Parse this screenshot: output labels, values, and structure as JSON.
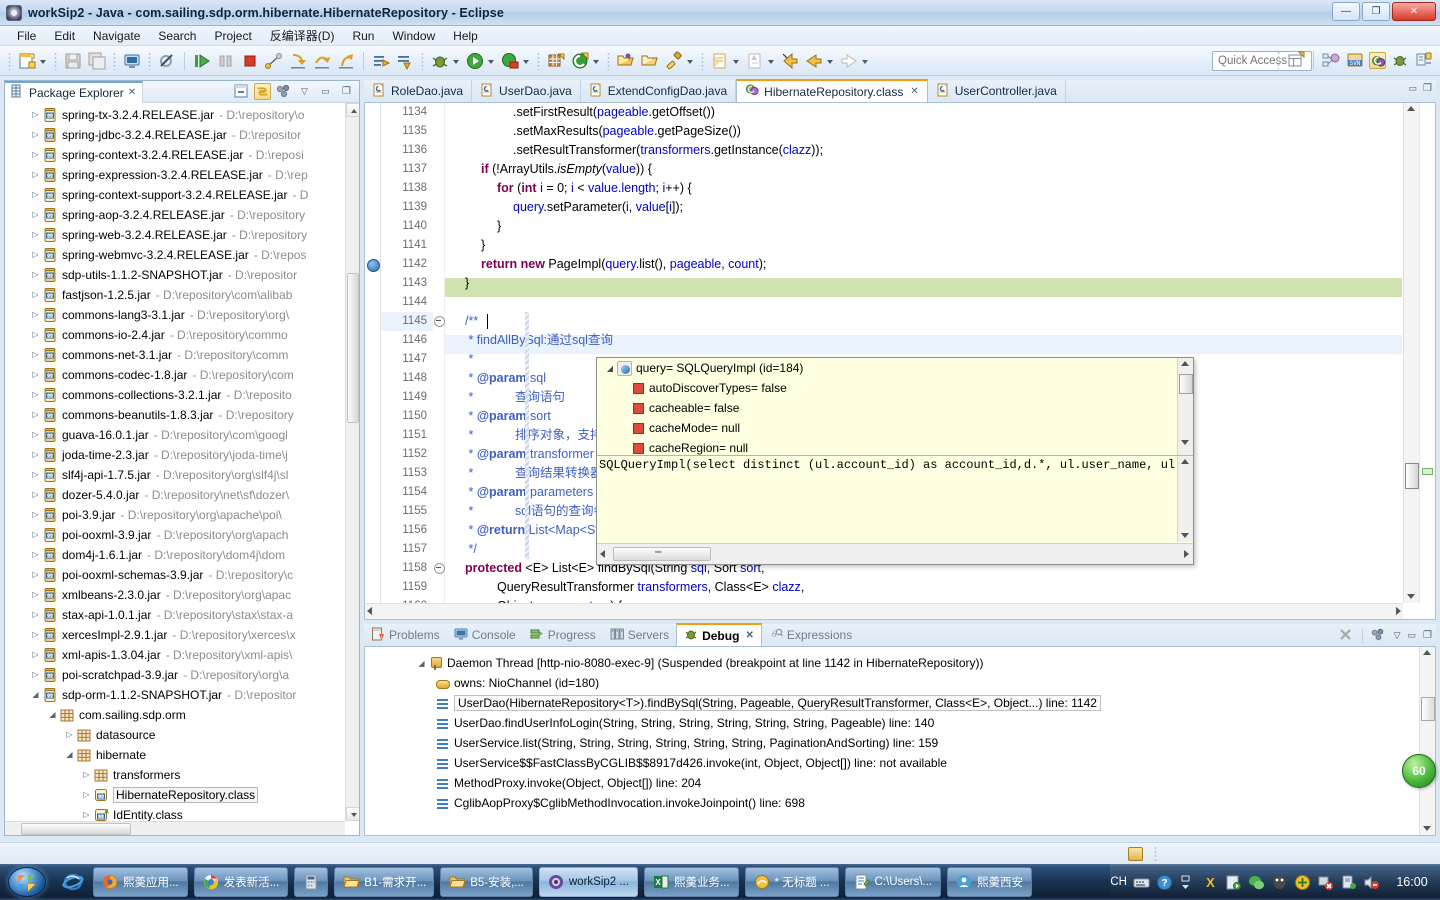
{
  "window": {
    "title": "workSip2 - Java - com.sailing.sdp.orm.hibernate.HibernateRepository - Eclipse",
    "minimize_label": "—",
    "maximize_label": "❐",
    "close_label": "✕"
  },
  "menubar": {
    "items": [
      "File",
      "Edit",
      "Navigate",
      "Search",
      "Project",
      "反编译器(D)",
      "Run",
      "Window",
      "Help"
    ]
  },
  "toolbar": {
    "quick_access_placeholder": "Quick Access",
    "left_icons": [
      "new-wizard-icon",
      "new-dropdown-arrow",
      "save-icon",
      "save-all-icon",
      "print-icon",
      "toggle-breakpoint-icon",
      "resume-icon",
      "suspend-icon",
      "terminate-icon",
      "disconnect-icon",
      "step-into-icon",
      "step-over-icon",
      "step-return-icon",
      "run-to-line-icon",
      "use-step-filters-icon",
      "debug-icon",
      "debug-dropdown-arrow",
      "run-icon",
      "run-dropdown-arrow",
      "coverage-icon",
      "coverage-dropdown-arrow",
      "new-java-package-icon",
      "new-java-class-icon",
      "new-class-dropdown-arrow",
      "open-type-icon",
      "open-task-icon",
      "search-icon",
      "search-dropdown-arrow",
      "next-annotation-icon",
      "next-annotation-dropdown-arrow",
      "previous-annotation-icon",
      "previous-annotation-dropdown-arrow",
      "back-icon",
      "forward-icon",
      "forward-dropdown-arrow",
      "next-edit-icon",
      "next-edit-dropdown-arrow"
    ],
    "right_icons": [
      "open-perspective-icon",
      "java-perspective-icon",
      "svn-perspective-icon",
      "java-ee-perspective-icon",
      "debug-perspective-icon",
      "team-sync-perspective-icon"
    ]
  },
  "package_explorer": {
    "title": "Package Explorer",
    "close_label": "✕",
    "toolbar_icons": [
      "collapse-all-icon",
      "link-with-editor-icon",
      "view-menu-icon",
      "minimize-icon",
      "maximize-icon"
    ],
    "view_menu_label": "▽",
    "minimize_label": "▭",
    "maximize_label": "❐",
    "items": [
      {
        "name": "spring-tx-3.2.4.RELEASE.jar",
        "path": "- D:\\repository\\o",
        "icon": "jar-src-icon",
        "indent": 2,
        "twisty": "▷"
      },
      {
        "name": "spring-jdbc-3.2.4.RELEASE.jar",
        "path": "- D:\\repositor",
        "icon": "jar-icon",
        "indent": 2,
        "twisty": "▷"
      },
      {
        "name": "spring-context-3.2.4.RELEASE.jar",
        "path": "- D:\\reposi",
        "icon": "jar-src-icon",
        "indent": 2,
        "twisty": "▷"
      },
      {
        "name": "spring-expression-3.2.4.RELEASE.jar",
        "path": "- D:\\rep",
        "icon": "jar-icon",
        "indent": 2,
        "twisty": "▷"
      },
      {
        "name": "spring-context-support-3.2.4.RELEASE.jar",
        "path": "- D",
        "icon": "jar-src-icon",
        "indent": 2,
        "twisty": "▷"
      },
      {
        "name": "spring-aop-3.2.4.RELEASE.jar",
        "path": "- D:\\repository",
        "icon": "jar-src-icon",
        "indent": 2,
        "twisty": "▷"
      },
      {
        "name": "spring-web-3.2.4.RELEASE.jar",
        "path": "- D:\\repository",
        "icon": "jar-src-icon",
        "indent": 2,
        "twisty": "▷"
      },
      {
        "name": "spring-webmvc-3.2.4.RELEASE.jar",
        "path": "- D:\\repos",
        "icon": "jar-src-icon",
        "indent": 2,
        "twisty": "▷"
      },
      {
        "name": "sdp-utils-1.1.2-SNAPSHOT.jar",
        "path": "- D:\\repositor",
        "icon": "jar-icon",
        "indent": 2,
        "twisty": "▷"
      },
      {
        "name": "fastjson-1.2.5.jar",
        "path": "- D:\\repository\\com\\alibab",
        "icon": "jar-src-icon",
        "indent": 2,
        "twisty": "▷"
      },
      {
        "name": "commons-lang3-3.1.jar",
        "path": "- D:\\repository\\org\\",
        "icon": "jar-src-icon",
        "indent": 2,
        "twisty": "▷"
      },
      {
        "name": "commons-io-2.4.jar",
        "path": "- D:\\repository\\commo",
        "icon": "jar-src-icon",
        "indent": 2,
        "twisty": "▷"
      },
      {
        "name": "commons-net-3.1.jar",
        "path": "- D:\\repository\\comm",
        "icon": "jar-icon",
        "indent": 2,
        "twisty": "▷"
      },
      {
        "name": "commons-codec-1.8.jar",
        "path": "- D:\\repository\\com",
        "icon": "jar-icon",
        "indent": 2,
        "twisty": "▷"
      },
      {
        "name": "commons-collections-3.2.1.jar",
        "path": "- D:\\reposito",
        "icon": "jar-src-icon",
        "indent": 2,
        "twisty": "▷"
      },
      {
        "name": "commons-beanutils-1.8.3.jar",
        "path": "- D:\\repository",
        "icon": "jar-icon",
        "indent": 2,
        "twisty": "▷"
      },
      {
        "name": "guava-16.0.1.jar",
        "path": "- D:\\repository\\com\\googl",
        "icon": "jar-icon",
        "indent": 2,
        "twisty": "▷"
      },
      {
        "name": "joda-time-2.3.jar",
        "path": "- D:\\repository\\joda-time\\j",
        "icon": "jar-icon",
        "indent": 2,
        "twisty": "▷"
      },
      {
        "name": "slf4j-api-1.7.5.jar",
        "path": "- D:\\repository\\org\\slf4j\\sl",
        "icon": "jar-src-icon",
        "indent": 2,
        "twisty": "▷"
      },
      {
        "name": "dozer-5.4.0.jar",
        "path": "- D:\\repository\\net\\sf\\dozer\\",
        "icon": "jar-icon",
        "indent": 2,
        "twisty": "▷"
      },
      {
        "name": "poi-3.9.jar",
        "path": "- D:\\repository\\org\\apache\\poi\\",
        "icon": "jar-icon",
        "indent": 2,
        "twisty": "▷"
      },
      {
        "name": "poi-ooxml-3.9.jar",
        "path": "- D:\\repository\\org\\apach",
        "icon": "jar-src-icon",
        "indent": 2,
        "twisty": "▷"
      },
      {
        "name": "dom4j-1.6.1.jar",
        "path": "- D:\\repository\\dom4j\\dom",
        "icon": "jar-icon",
        "indent": 2,
        "twisty": "▷"
      },
      {
        "name": "poi-ooxml-schemas-3.9.jar",
        "path": "- D:\\repository\\c",
        "icon": "jar-icon",
        "indent": 2,
        "twisty": "▷"
      },
      {
        "name": "xmlbeans-2.3.0.jar",
        "path": "- D:\\repository\\org\\apac",
        "icon": "jar-icon",
        "indent": 2,
        "twisty": "▷"
      },
      {
        "name": "stax-api-1.0.1.jar",
        "path": "- D:\\repository\\stax\\stax-a",
        "icon": "jar-icon",
        "indent": 2,
        "twisty": "▷"
      },
      {
        "name": "xercesImpl-2.9.1.jar",
        "path": "- D:\\repository\\xerces\\x",
        "icon": "jar-icon",
        "indent": 2,
        "twisty": "▷"
      },
      {
        "name": "xml-apis-1.3.04.jar",
        "path": "- D:\\repository\\xml-apis\\",
        "icon": "jar-icon",
        "indent": 2,
        "twisty": "▷"
      },
      {
        "name": "poi-scratchpad-3.9.jar",
        "path": "- D:\\repository\\org\\a",
        "icon": "jar-icon",
        "indent": 2,
        "twisty": "▷"
      },
      {
        "name": "sdp-orm-1.1.2-SNAPSHOT.jar",
        "path": "- D:\\repositor",
        "icon": "jar-src-icon",
        "indent": 2,
        "twisty": "◢"
      },
      {
        "name": "com.sailing.sdp.orm",
        "path": "",
        "icon": "package-icon",
        "indent": 3,
        "twisty": "◢"
      },
      {
        "name": "datasource",
        "path": "",
        "icon": "package-icon",
        "indent": 4,
        "twisty": "▷"
      },
      {
        "name": "hibernate",
        "path": "",
        "icon": "package-icon",
        "indent": 4,
        "twisty": "◢"
      },
      {
        "name": "transformers",
        "path": "",
        "icon": "package-icon",
        "indent": 5,
        "twisty": "▷"
      },
      {
        "name": "HibernateRepository.class",
        "path": "",
        "icon": "class-icon",
        "indent": 5,
        "twisty": "▷",
        "selected": true
      },
      {
        "name": "IdEntity.class",
        "path": "",
        "icon": "class-abstract-icon",
        "indent": 5,
        "twisty": "▷"
      }
    ]
  },
  "editor": {
    "tabs": [
      {
        "label": "RoleDao.java",
        "icon": "java-file-icon",
        "active": false
      },
      {
        "label": "UserDao.java",
        "icon": "java-file-icon",
        "active": false
      },
      {
        "label": "ExtendConfigDao.java",
        "icon": "java-file-icon",
        "active": false
      },
      {
        "label": "HibernateRepository.class",
        "icon": "class-file-icon",
        "active": true,
        "close_label": "✕"
      },
      {
        "label": "UserController.java",
        "icon": "java-file-icon",
        "active": false
      }
    ],
    "minimize_label": "▭",
    "maximize_label": "❐",
    "first_line_number": 1134,
    "current_line": 1145,
    "breakpoint_line": 1142,
    "highlighted_line": 1142,
    "lines": [
      {
        "n": 1134,
        "indent": "\t\t\t\t",
        "text": ".setFirstResult(pageable.getOffset())"
      },
      {
        "n": 1135,
        "indent": "\t\t\t\t",
        "text": ".setMaxResults(pageable.getPageSize())"
      },
      {
        "n": 1136,
        "indent": "\t\t\t\t",
        "text": ".setResultTransformer(transformers.getInstance(clazz));"
      },
      {
        "n": 1137,
        "indent": "\t\t",
        "text": "if (!ArrayUtils.isEmpty(value)) {"
      },
      {
        "n": 1138,
        "indent": "\t\t\t",
        "text": "for (int i = 0; i < value.length; i++) {"
      },
      {
        "n": 1139,
        "indent": "\t\t\t\t",
        "text": "query.setParameter(i, value[i]);"
      },
      {
        "n": 1140,
        "indent": "\t\t\t",
        "text": "}"
      },
      {
        "n": 1141,
        "indent": "\t\t",
        "text": "}"
      },
      {
        "n": 1142,
        "indent": "\t\t",
        "text": "return new PageImpl(query.list(), pageable, count);"
      },
      {
        "n": 1143,
        "indent": "\t",
        "text": "}"
      },
      {
        "n": 1144,
        "indent": "",
        "text": ""
      },
      {
        "n": 1145,
        "indent": "\t",
        "text": "/**"
      },
      {
        "n": 1146,
        "indent": "\t",
        "text": " * findAllBySql:通过sql查询"
      },
      {
        "n": 1147,
        "indent": "\t",
        "text": " * "
      },
      {
        "n": 1148,
        "indent": "\t",
        "text": " * @param sql"
      },
      {
        "n": 1149,
        "indent": "\t",
        "text": " *            查询语句"
      },
      {
        "n": 1150,
        "indent": "\t",
        "text": " * @param sort"
      },
      {
        "n": 1151,
        "indent": "\t",
        "text": " *            排序对象，支持多"
      },
      {
        "n": 1152,
        "indent": "\t",
        "text": " * @param transformer"
      },
      {
        "n": 1153,
        "indent": "\t",
        "text": " *            查询结果转换器"
      },
      {
        "n": 1154,
        "indent": "\t",
        "text": " * @param parameters"
      },
      {
        "n": 1155,
        "indent": "\t",
        "text": " *            sql语句的查询参数"
      },
      {
        "n": 1156,
        "indent": "\t",
        "text": " * @return List<Map<String,Object>>"
      },
      {
        "n": 1157,
        "indent": "\t",
        "text": " */"
      },
      {
        "n": 1158,
        "indent": "\t",
        "text": "protected <E> List<E> findBySql(String sql, Sort sort,"
      },
      {
        "n": 1159,
        "indent": "\t\t\t",
        "text": "QueryResultTransformer transformers, Class<E> clazz,"
      },
      {
        "n": 1160,
        "indent": "\t\t\t",
        "text": "Object... parameters) {"
      }
    ]
  },
  "hover_popup": {
    "variables": [
      {
        "label": "query= SQLQueryImpl  (id=184)",
        "icon": "object-icon",
        "twisty": "◢",
        "depth": 0
      },
      {
        "label": "autoDiscoverTypes= false",
        "icon": "field-private-icon",
        "depth": 1
      },
      {
        "label": "cacheable= false",
        "icon": "field-private-icon",
        "depth": 1
      },
      {
        "label": "cacheMode= null",
        "icon": "field-private-icon",
        "depth": 1
      },
      {
        "label": "cacheRegion= null",
        "icon": "field-private-icon",
        "depth": 1
      }
    ],
    "detail": "SQLQueryImpl(select distinct (ul.account_id) as account_id,d.*, ul.user_name, ul.st"
  },
  "bottom_view": {
    "tabs": [
      {
        "label": "Problems",
        "icon": "problems-icon",
        "active": false
      },
      {
        "label": "Console",
        "icon": "console-icon",
        "active": false
      },
      {
        "label": "Progress",
        "icon": "progress-icon",
        "active": false
      },
      {
        "label": "Servers",
        "icon": "servers-icon",
        "active": false
      },
      {
        "label": "Debug",
        "icon": "debug-icon",
        "active": true,
        "close_label": "✕"
      },
      {
        "label": "Expressions",
        "icon": "expressions-icon",
        "active": false
      }
    ],
    "toolbar_icons": [
      "remove-all-terminated-icon",
      "view-menu-icon",
      "minimize-icon",
      "maximize-icon"
    ],
    "view_menu_label": "▽",
    "minimize_label": "▭",
    "maximize_label": "❐",
    "stack": [
      {
        "label": "Daemon Thread [http-nio-8080-exec-9] (Suspended (breakpoint at line 1142 in HibernateRepository))",
        "icon": "thread-icon",
        "indent": 1,
        "twisty": "◢"
      },
      {
        "label": "owns: NioChannel  (id=180)",
        "icon": "monitor-icon",
        "indent": 2
      },
      {
        "label": "UserDao(HibernateRepository<T>).findBySql(String, Pageable, QueryResultTransformer, Class<E>, Object...) line: 1142",
        "icon": "stack-frame-icon",
        "indent": 2,
        "selected": true
      },
      {
        "label": "UserDao.findUserInfoLogin(String, String, String, String, String, String, Pageable) line: 140",
        "icon": "stack-frame-icon",
        "indent": 2
      },
      {
        "label": "UserService.list(String, String, String, String, String, String, PaginationAndSorting) line: 159",
        "icon": "stack-frame-icon",
        "indent": 2
      },
      {
        "label": "UserService$$FastClassByCGLIB$$8917d426.invoke(int, Object, Object[]) line: not available",
        "icon": "stack-frame-icon",
        "indent": 2
      },
      {
        "label": "MethodProxy.invoke(Object, Object[]) line: 204",
        "icon": "stack-frame-icon",
        "indent": 2
      },
      {
        "label": "CglibAopProxy$CglibMethodInvocation.invokeJoinpoint() line: 698",
        "icon": "stack-frame-icon",
        "indent": 2
      }
    ]
  },
  "overlay": {
    "badge_text": "60"
  },
  "taskbar": {
    "start_label": "Start",
    "quick_launch": [
      "internet-explorer-icon"
    ],
    "items": [
      {
        "label": "熙羮应用...",
        "icon": "firefox-icon",
        "active": false
      },
      {
        "label": "发表新活...",
        "icon": "chrome-icon",
        "active": false
      },
      {
        "label": "",
        "icon": "calculator-icon",
        "active": false
      },
      {
        "label": "B1-需求开...",
        "icon": "folder-icon",
        "active": false
      },
      {
        "label": "B5-安装,...",
        "icon": "folder-icon",
        "active": false
      },
      {
        "label": "workSip2 ...",
        "icon": "eclipse-icon",
        "active": true
      },
      {
        "label": "熙羮业务...",
        "icon": "excel-icon",
        "active": false
      },
      {
        "label": "* 无标题 ...",
        "icon": "notepad-plus-icon",
        "active": false
      },
      {
        "label": "C:\\Users\\...",
        "icon": "editplus-icon",
        "active": false
      },
      {
        "label": "熙羮西安",
        "icon": "im-icon",
        "active": false
      }
    ],
    "tray": {
      "ime_label": "CH",
      "icons": [
        "keyboard-icon",
        "help-icon",
        "show-hidden-icons-arrow",
        "xunlei-icon",
        "screenshot-icon",
        "wechat-icon",
        "qq-icon",
        "security-icon",
        "network-error-icon",
        "removable-media-icon",
        "volume-muted-icon"
      ],
      "clock": "16:00"
    }
  }
}
